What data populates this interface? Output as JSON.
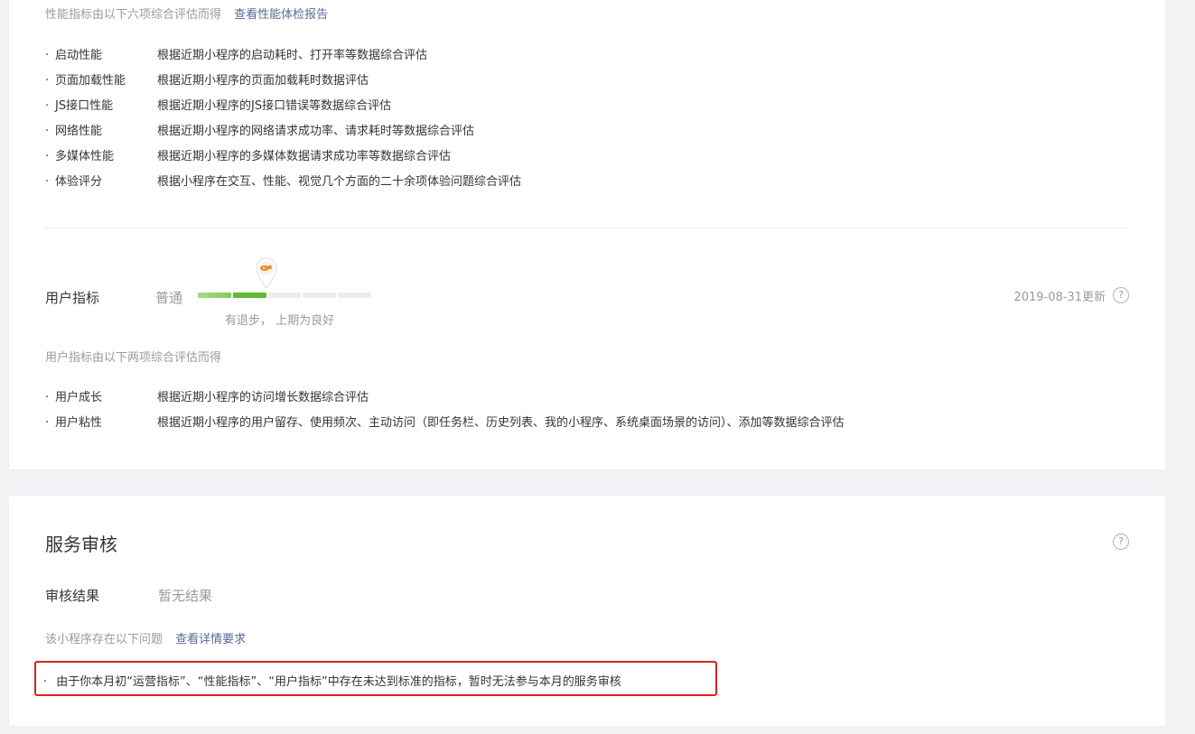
{
  "performance": {
    "desc": "性能指标由以下六项综合评估而得",
    "report_link": "查看性能体检报告",
    "items": [
      {
        "name": "启动性能",
        "text": "根据近期小程序的启动耗时、打开率等数据综合评估"
      },
      {
        "name": "页面加载性能",
        "text": "根据近期小程序的页面加载耗时数据评估"
      },
      {
        "name": "JS接口性能",
        "text": "根据近期小程序的JS接口错误等数据综合评估"
      },
      {
        "name": "网络性能",
        "text": "根据近期小程序的网络请求成功率、请求耗时等数据综合评估"
      },
      {
        "name": "多媒体性能",
        "text": "根据近期小程序的多媒体数据请求成功率等数据综合评估"
      },
      {
        "name": "体验评分",
        "text": "根据小程序在交互、性能、视觉几个方面的二十余项体验问题综合评估"
      }
    ]
  },
  "user_metric": {
    "label": "用户指标",
    "level": "普通",
    "level_index": 2,
    "level_count": 5,
    "caption": "有退步， 上期为良好",
    "update_time": "2019-08-31更新",
    "desc": "用户指标由以下两项综合评估而得",
    "items": [
      {
        "name": "用户成长",
        "text": "根据近期小程序的访问增长数据综合评估"
      },
      {
        "name": "用户粘性",
        "text": "根据近期小程序的用户留存、使用频次、主动访问（即任务栏、历史列表、我的小程序、系统桌面场景的访问）、添加等数据综合评估"
      }
    ]
  },
  "service_review": {
    "title": "服务审核",
    "result_label": "审核结果",
    "result_value": "暂无结果",
    "issues_desc": "该小程序存在以下问题",
    "detail_link": "查看详情要求",
    "issue": "由于你本月初“运营指标”、“性能指标”、“用户指标”中存在未达到标准的指标，暂时无法参与本月的服务审核"
  },
  "icons": {
    "help": "?",
    "bullet": "·"
  },
  "colors": {
    "accent_link": "#576b95",
    "progress_green": "#5dbb34",
    "highlight_red": "#e02020",
    "marker_orange": "#f08a2b"
  }
}
